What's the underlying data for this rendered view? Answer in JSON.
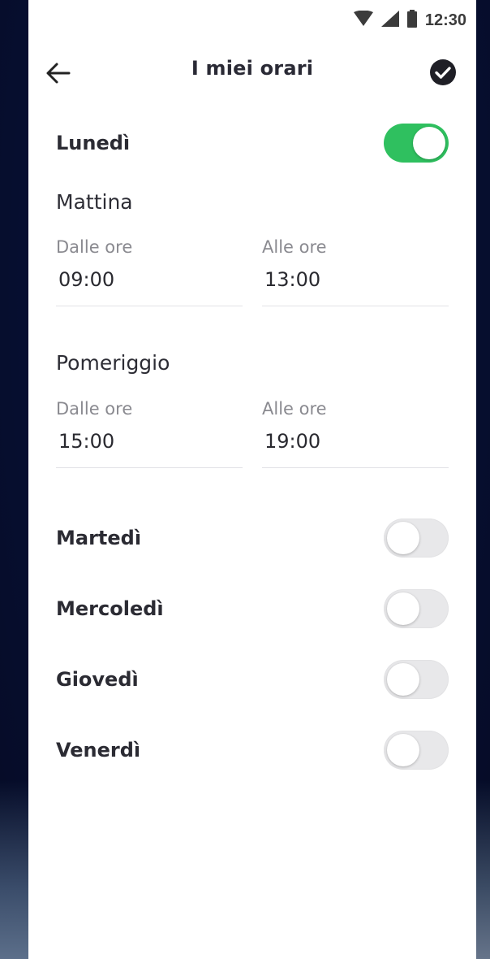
{
  "status_bar": {
    "time": "12:30",
    "icons": [
      "wifi-icon",
      "signal-icon",
      "battery-icon"
    ]
  },
  "header": {
    "title": "I miei orari",
    "back_icon": "arrow-left-icon",
    "save_icon": "check-circle-icon"
  },
  "colors": {
    "toggle_on": "#2fc05f",
    "toggle_off": "#e8e8ea",
    "text": "#2b2b33",
    "muted": "#8a8a90"
  },
  "days": [
    {
      "label": "Lunedì",
      "enabled": true,
      "slots": [
        {
          "title": "Mattina",
          "from_label": "Dalle ore",
          "from": "09:00",
          "to_label": "Alle ore",
          "to": "13:00"
        },
        {
          "title": "Pomeriggio",
          "from_label": "Dalle ore",
          "from": "15:00",
          "to_label": "Alle ore",
          "to": "19:00"
        }
      ]
    },
    {
      "label": "Martedì",
      "enabled": false
    },
    {
      "label": "Mercoledì",
      "enabled": false
    },
    {
      "label": "Giovedì",
      "enabled": false
    },
    {
      "label": "Venerdì",
      "enabled": false
    }
  ]
}
